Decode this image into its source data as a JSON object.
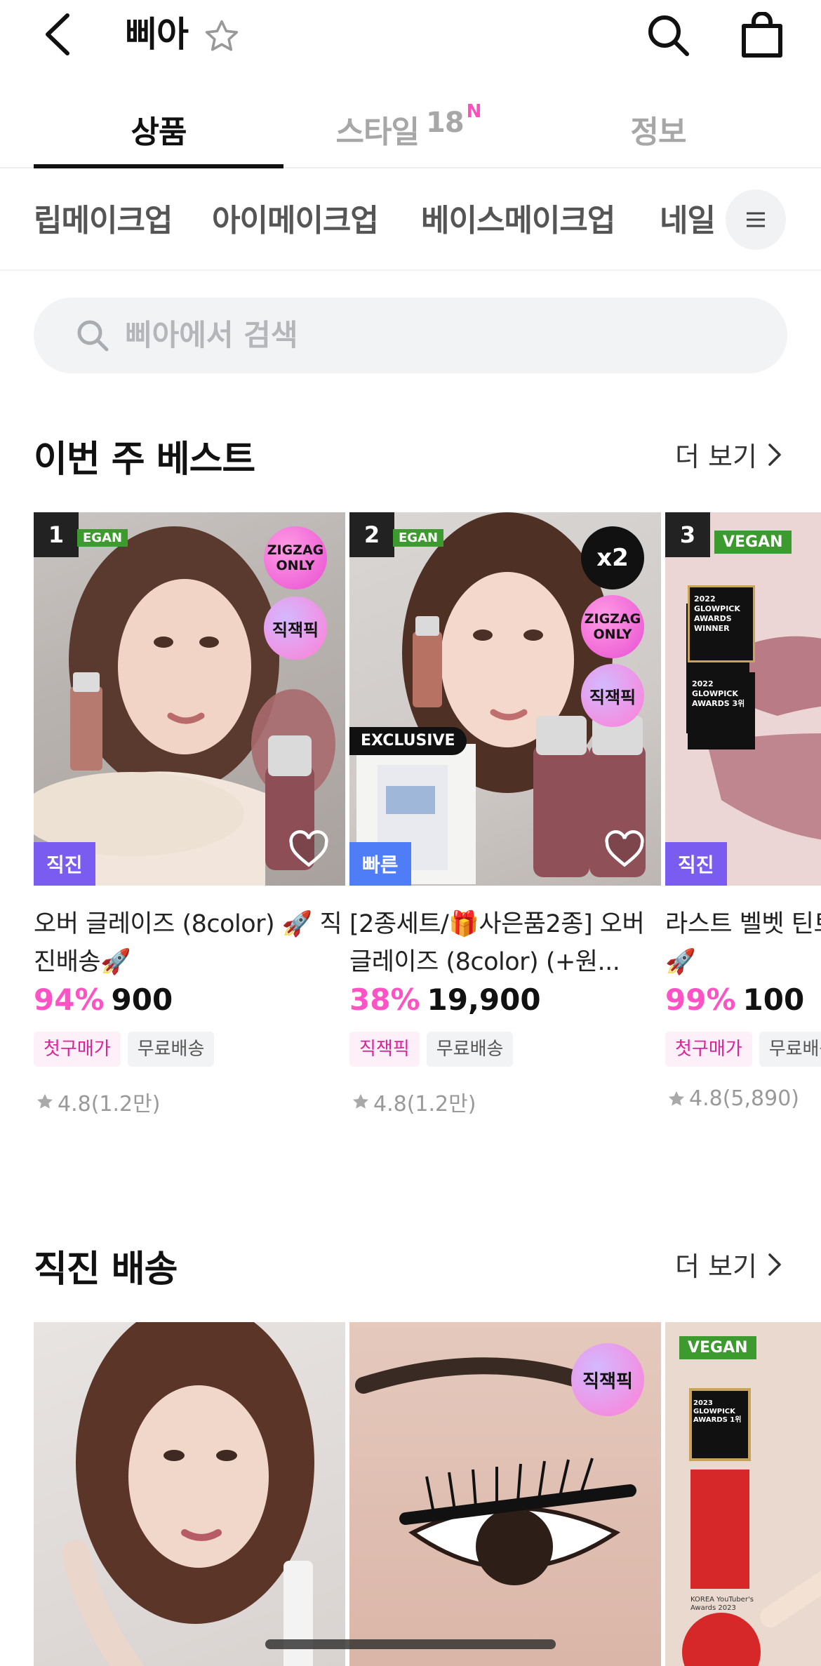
{
  "header": {
    "title": "삐아"
  },
  "tabs": [
    {
      "label": "상품"
    },
    {
      "label": "스타일",
      "count": "18",
      "new_mark": "N"
    },
    {
      "label": "정보"
    }
  ],
  "categories": [
    "립메이크업",
    "아이메이크업",
    "베이스메이크업",
    "네일"
  ],
  "search": {
    "placeholder": "삐아에서 검색"
  },
  "best_section": {
    "title": "이번 주 베스트",
    "more_label": "더 보기",
    "products": [
      {
        "rank": "1",
        "vegan_label": "EGAN",
        "badges": [
          "ZIGZAG ONLY",
          "직잭픽"
        ],
        "ship_tag": "직진",
        "title": "오버 글레이즈 (8color) 🚀 직진배송🚀",
        "discount": "94%",
        "price": "900",
        "chips": [
          "첫구매가",
          "무료배송"
        ],
        "rating": "4.8(1.2만)"
      },
      {
        "rank": "2",
        "vegan_label": "EGAN",
        "badges": [
          "x2",
          "ZIGZAG ONLY",
          "직잭픽"
        ],
        "exclusive_label": "EXCLUSIVE",
        "ship_tag": "빠른",
        "title": "[2종세트/🎁사은품2종] 오버 글레이즈 (8color) (+원...",
        "discount": "38%",
        "price": "19,900",
        "chips": [
          "직잭픽",
          "무료배송"
        ],
        "rating": "4.8(1.2만)"
      },
      {
        "rank": "3",
        "vegan_label": "VEGAN",
        "award_lines": [
          "2022 GLOWPICK AWARDS WINNER",
          "2022 GLOWPICK AWARDS 3위"
        ],
        "ship_tag": "직진",
        "title": "라스트 벨벳 틴트 🚀직진배송🚀",
        "discount": "99%",
        "price": "100",
        "chips": [
          "첫구매가",
          "무료배송"
        ],
        "rating": "4.8(5,890)"
      }
    ]
  },
  "direct_section": {
    "title": "직진 배송",
    "more_label": "더 보기",
    "products": [
      {
        "badge": ""
      },
      {
        "badge": "직잭픽"
      },
      {
        "vegan_label": "VEGAN",
        "award_line": "2023 GLOWPICK AWARDS 1위",
        "caption": "KOREA YouTuber's Awards 2023"
      }
    ]
  },
  "colors": {
    "accent_pink": "#ff52c4",
    "ship_direct": "#7b5cf0",
    "ship_fast": "#4f7cf7",
    "text_dark": "#111111"
  }
}
